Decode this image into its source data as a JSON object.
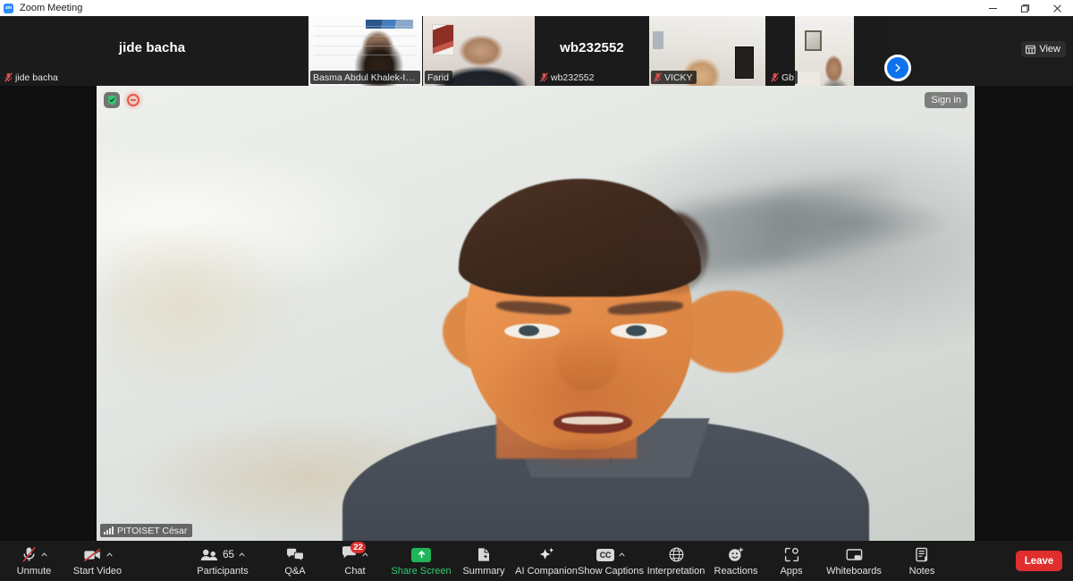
{
  "window": {
    "title": "Zoom Meeting",
    "logo_text": "zm",
    "controls": [
      {
        "name": "minimize",
        "icon": "minimize-icon"
      },
      {
        "name": "maximize",
        "icon": "maximize-icon"
      },
      {
        "name": "close",
        "icon": "close-icon"
      }
    ]
  },
  "filmstrip": {
    "view_button_label": "View",
    "view_button_icon": "grid-view-icon",
    "next_page_icon": "chevron-right-icon",
    "thumbnails": [
      {
        "label": "jide bacha",
        "big_name": "jide bacha",
        "muted": true,
        "has_video": false
      },
      {
        "label": "Basma Abdul Khalek-Instit...",
        "big_name": "",
        "muted": false,
        "has_video": true
      },
      {
        "label": "Farid",
        "big_name": "",
        "muted": false,
        "has_video": true
      },
      {
        "label": "wb232552",
        "big_name": "wb232552",
        "muted": true,
        "has_video": false
      },
      {
        "label": "VICKY",
        "big_name": "",
        "muted": true,
        "has_video": true
      },
      {
        "label": "Gb",
        "big_name": "",
        "muted": true,
        "has_video": true
      }
    ]
  },
  "main_video": {
    "participant_name": "PITOISET César",
    "signal_icon": "signal-strength-icon",
    "sign_in_label": "Sign in",
    "shield_icon": "shield-check-icon",
    "recording_icon": "recording-indicator-icon"
  },
  "toolbar": {
    "items": [
      {
        "label": "Unmute",
        "icon": "microphone-muted-icon",
        "caret": true,
        "badge": "",
        "count": "",
        "accent": ""
      },
      {
        "label": "Start Video",
        "icon": "camera-muted-icon",
        "caret": true,
        "badge": "",
        "count": "",
        "accent": ""
      },
      {
        "label": "Participants",
        "icon": "participants-icon",
        "caret": true,
        "badge": "",
        "count": "65",
        "accent": ""
      },
      {
        "label": "Q&A",
        "icon": "qa-bubbles-icon",
        "caret": false,
        "badge": "",
        "count": "",
        "accent": ""
      },
      {
        "label": "Chat",
        "icon": "chat-bubble-icon",
        "caret": true,
        "badge": "22",
        "count": "",
        "accent": ""
      },
      {
        "label": "Share Screen",
        "icon": "share-screen-icon",
        "caret": false,
        "badge": "",
        "count": "",
        "accent": "#2ecc71"
      },
      {
        "label": "Summary",
        "icon": "summary-doc-icon",
        "caret": false,
        "badge": "",
        "count": "",
        "accent": ""
      },
      {
        "label": "AI Companion",
        "icon": "ai-sparkle-icon",
        "caret": false,
        "badge": "",
        "count": "",
        "accent": ""
      },
      {
        "label": "Show Captions",
        "icon": "closed-captions-icon",
        "caret": true,
        "badge": "",
        "count": "",
        "accent": ""
      },
      {
        "label": "Interpretation",
        "icon": "globe-icon",
        "caret": false,
        "badge": "",
        "count": "",
        "accent": ""
      },
      {
        "label": "Reactions",
        "icon": "reactions-smiley-icon",
        "caret": false,
        "badge": "",
        "count": "",
        "accent": ""
      },
      {
        "label": "Apps",
        "icon": "apps-icon",
        "caret": false,
        "badge": "",
        "count": "",
        "accent": ""
      },
      {
        "label": "Whiteboards",
        "icon": "whiteboard-icon",
        "caret": false,
        "badge": "",
        "count": "",
        "accent": ""
      },
      {
        "label": "Notes",
        "icon": "notes-icon",
        "caret": false,
        "badge": "",
        "count": "",
        "accent": ""
      }
    ],
    "leave_label": "Leave"
  },
  "colors": {
    "accent_blue": "#0e72ed",
    "danger_red": "#e02d2d",
    "share_green": "#2ecc71",
    "toolbar_bg": "#1a1a1a",
    "strip_bg": "#1c1c1c"
  }
}
